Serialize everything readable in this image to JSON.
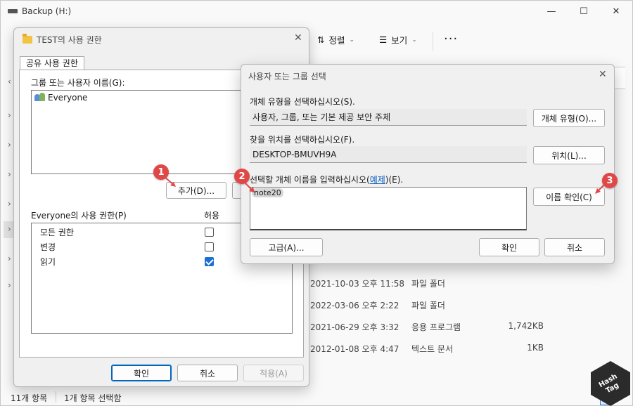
{
  "explorer": {
    "title": "Backup (H:)",
    "window_buttons": [
      "—",
      "☐",
      "✕"
    ],
    "toolbar": {
      "sort_label": "정렬",
      "view_label": "보기",
      "more": "···"
    },
    "files": [
      {
        "date": "2021-10-03 오후 11:58",
        "type": "파일 폴더",
        "size": ""
      },
      {
        "date": "2022-03-06 오후 2:22",
        "type": "파일 폴더",
        "size": ""
      },
      {
        "date": "2021-06-29 오후 3:32",
        "type": "응용 프로그램",
        "size": "1,742KB"
      },
      {
        "date": "2012-01-08 오후 4:47",
        "type": "텍스트 문서",
        "size": "1KB"
      }
    ],
    "status": {
      "count": "11개 항목",
      "selected": "1개 항목 선택함"
    }
  },
  "permissions_dialog": {
    "title": "TEST의 사용 권한",
    "tab": "공유 사용 권한",
    "group_label": "그룹 또는 사용자 이름(G):",
    "users": [
      "Everyone"
    ],
    "add_button": "추가(D)...",
    "perm_label": "Everyone의 사용 권한(P)",
    "allow_header": "허용",
    "permissions": [
      {
        "name": "모든 권한",
        "allow": false
      },
      {
        "name": "변경",
        "allow": false
      },
      {
        "name": "읽기",
        "allow": true
      }
    ],
    "ok": "확인",
    "cancel": "취소",
    "apply": "적용(A)"
  },
  "select_dialog": {
    "title": "사용자 또는 그룹 선택",
    "object_type_label": "개체 유형을 선택하십시오(S).",
    "object_type_value": "사용자, 그룹, 또는 기본 제공 보안 주체",
    "object_type_button": "개체 유형(O)...",
    "location_label": "찾을 위치를 선택하십시오(F).",
    "location_value": "DESKTOP-BMUVH9A",
    "location_button": "위치(L)...",
    "enter_label_prefix": "선택할 개체 이름을 입력하십시오(",
    "enter_label_link": "예제",
    "enter_label_suffix": ")(E).",
    "entered_name": "note20",
    "check_names_button": "이름 확인(C)",
    "advanced_button": "고급(A)...",
    "ok": "확인",
    "cancel": "취소"
  },
  "markers": [
    "1",
    "2",
    "3"
  ],
  "badge": {
    "text": "Hash Tag"
  },
  "colors": {
    "accent": "#0067c0",
    "marker": "#e04848",
    "link": "#0a5bc4"
  }
}
